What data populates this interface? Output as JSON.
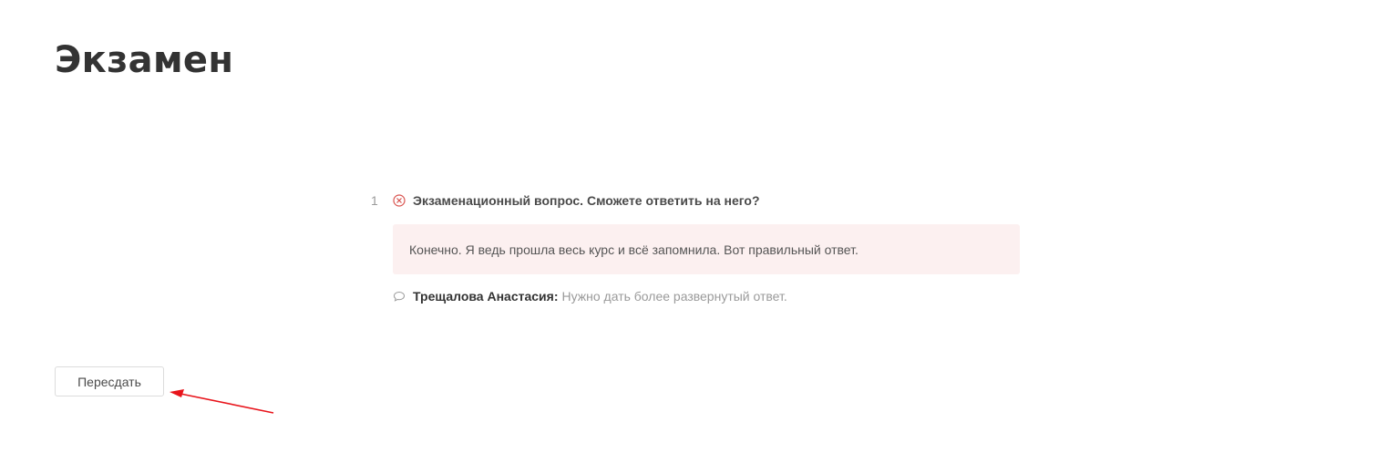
{
  "page": {
    "title": "Экзамен"
  },
  "question": {
    "number": "1",
    "status_icon": "incorrect-circle-x-icon",
    "text": "Экзаменационный вопрос. Сможете ответить на него?",
    "answer": "Конечно. Я ведь прошла весь курс и всё запомнила. Вот правильный ответ.",
    "comment": {
      "icon": "speech-bubble-icon",
      "author": "Трещалова Анастасия:",
      "text": "Нужно дать более развернутый ответ."
    }
  },
  "actions": {
    "retake_label": "Пересдать"
  },
  "colors": {
    "incorrect": "#d9534f",
    "answer_background": "#fcf0f0",
    "annotation_arrow": "#e8141b"
  }
}
